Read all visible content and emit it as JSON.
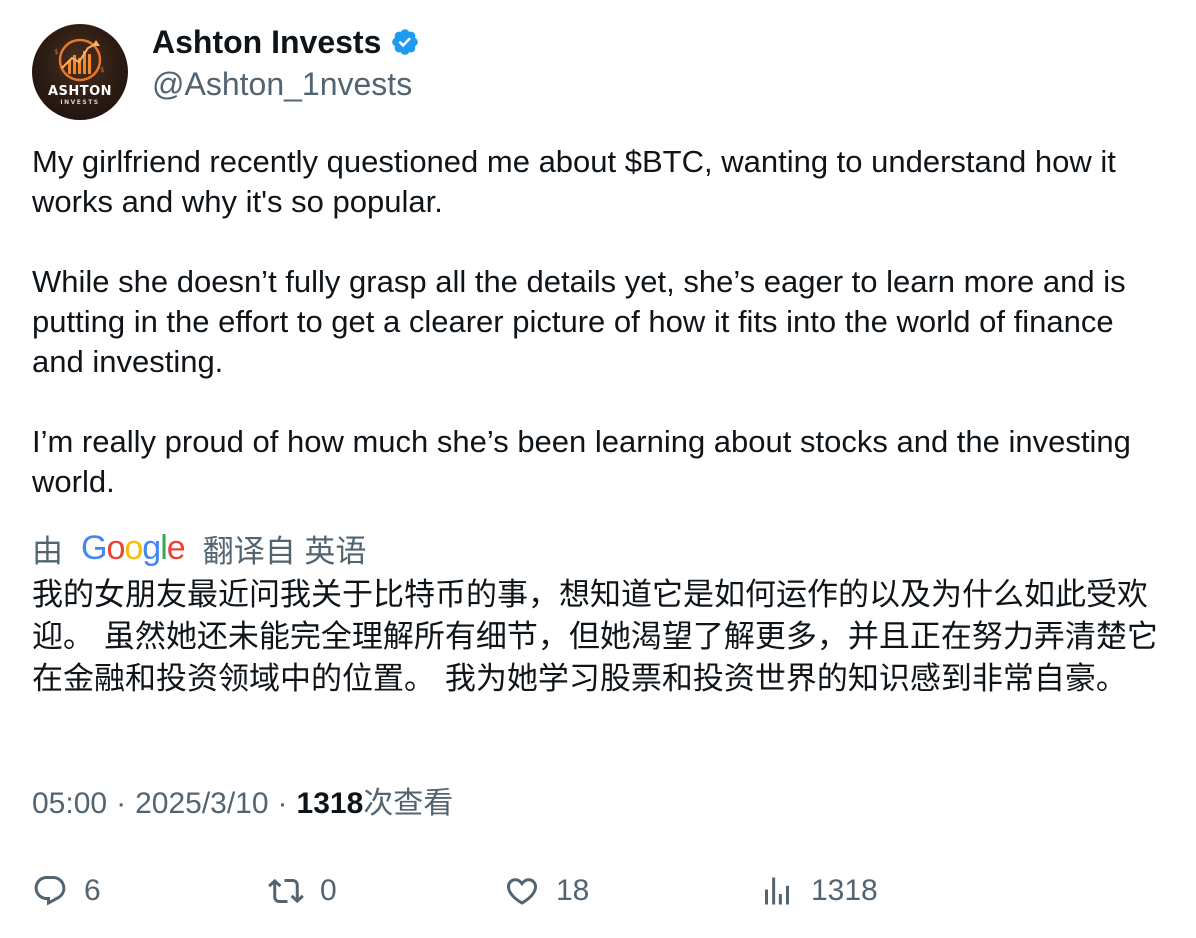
{
  "author": {
    "display_name": "Ashton Invests",
    "handle": "@Ashton_1nvests",
    "avatar_brand": "ASHTON",
    "avatar_sub": "INVESTS",
    "verified": true,
    "verified_color": "#1d9bf0"
  },
  "tweet": {
    "paragraphs": [
      "My girlfriend recently questioned me about $BTC, wanting to understand how it works and why it's so popular.",
      "While she doesn’t fully grasp all the details yet, she’s eager to learn more and is putting in the effort to get a clearer picture of how it fits into the world of finance and investing.",
      "I’m really proud of how much she’s been learning about stocks and the investing world."
    ]
  },
  "translation": {
    "prefix": "由",
    "provider_logo": "Google",
    "suffix": "翻译自 英语",
    "text": "我的女朋友最近问我关于比特币的事，想知道它是如何运作的以及为什么如此受欢迎。 虽然她还未能完全理解所有细节，但她渴望了解更多，并且正在努力弄清楚它在金融和投资领域中的位置。 我为她学习股票和投资世界的知识感到非常自豪。"
  },
  "meta": {
    "time": "05:00",
    "separator": "·",
    "date": "2025/3/10",
    "views_count": "1318",
    "views_label": "次查看"
  },
  "actions": {
    "replies": "6",
    "reposts": "0",
    "likes": "18",
    "views": "1318"
  },
  "colors": {
    "text_primary": "#0f1419",
    "text_secondary": "#536471",
    "accent": "#1d9bf0"
  }
}
